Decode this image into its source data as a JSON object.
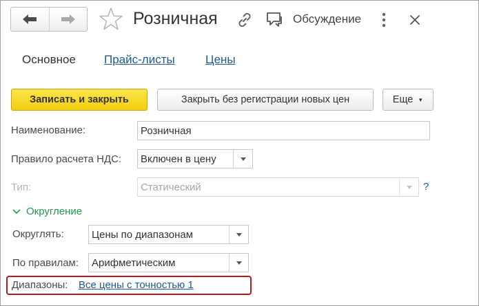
{
  "header": {
    "title": "Розничная",
    "discussion_label": "Обсуждение",
    "icons": [
      "back-arrow-icon",
      "forward-arrow-icon",
      "star-icon",
      "link-icon",
      "discussion-icon",
      "more-icon",
      "close-icon"
    ]
  },
  "tabs": {
    "main": "Основное",
    "price_lists": "Прайс-листы",
    "prices": "Цены"
  },
  "toolbar": {
    "save_close": "Записать и закрыть",
    "close_no_reg": "Закрыть без регистрации новых цен",
    "more": "Еще"
  },
  "form": {
    "name_label": "Наименование:",
    "name_value": "Розничная",
    "vat_label": "Правило расчета НДС:",
    "vat_value": "Включен в цену",
    "type_label": "Тип:",
    "type_value": "Статический",
    "help": "?"
  },
  "rounding": {
    "group_title": "Округление",
    "round_label": "Округлять:",
    "round_value": "Цены по диапазонам",
    "rules_label": "По правилам:",
    "rules_value": "Арифметическим",
    "ranges_label": "Диапазоны:",
    "ranges_link": "Все цены с точностью 1"
  },
  "colors": {
    "primary_button": "#f2cf10",
    "link": "#1c5a96",
    "group_title": "#1f9b4a",
    "highlight": "#c0141c"
  }
}
